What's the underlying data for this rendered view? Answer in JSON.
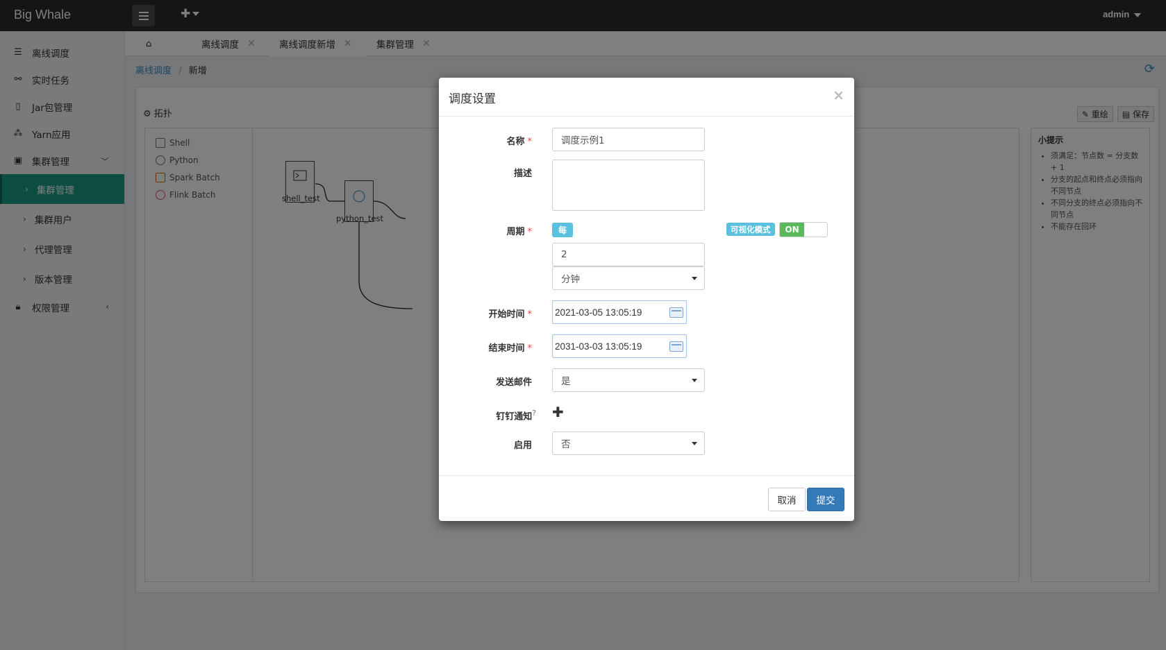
{
  "app": {
    "brand": "Big Whale",
    "user": "admin"
  },
  "sidebar": {
    "items": [
      {
        "label": "离线调度",
        "icon": "list-icon"
      },
      {
        "label": "实时任务",
        "icon": "link-icon"
      },
      {
        "label": "Jar包管理",
        "icon": "file-icon"
      },
      {
        "label": "Yarn应用",
        "icon": "cubes-icon"
      },
      {
        "label": "集群管理",
        "icon": "server-icon"
      },
      {
        "label": "权限管理",
        "icon": "lock-icon"
      }
    ],
    "sub_items": [
      {
        "label": "集群管理",
        "active": true
      },
      {
        "label": "集群用户",
        "active": false
      },
      {
        "label": "代理管理",
        "active": false
      },
      {
        "label": "版本管理",
        "active": false
      }
    ]
  },
  "tabs": [
    {
      "label": "离线调度"
    },
    {
      "label": "离线调度新增"
    },
    {
      "label": "集群管理"
    }
  ],
  "breadcrumb": {
    "parent": "离线调度",
    "current": "新增"
  },
  "panel": {
    "title": "拓扑",
    "redraw_label": "重绘",
    "save_label": "保存",
    "palette": [
      "Shell",
      "Python",
      "Spark Batch",
      "Flink Batch"
    ],
    "nodes": [
      "shell_test",
      "python_test"
    ],
    "tips_title": "小提示",
    "tips": [
      "须满足：节点数 = 分支数 + 1",
      "分支的起点和终点必须指向不同节点",
      "不同分支的终点必须指向不同节点",
      "不能存在回环"
    ]
  },
  "modal": {
    "title": "调度设置",
    "close": "×",
    "name_label": "名称",
    "name_value": "调度示例1",
    "desc_label": "描述",
    "desc_value": "",
    "period_label": "周期",
    "period_badge": "每",
    "period_value": "2",
    "period_unit": "分钟",
    "visual_mode_label": "可视化模式",
    "visual_mode_state": "ON",
    "start_label": "开始时间",
    "start_value": "2021-03-05 13:05:19",
    "end_label": "结束时间",
    "end_value": "2031-03-03 13:05:19",
    "mail_label": "发送邮件",
    "mail_value": "是",
    "dingding_label": "钉钉通知",
    "dingding_hint": "?",
    "enable_label": "启用",
    "enable_value": "否",
    "cancel_label": "取消",
    "submit_label": "提交"
  },
  "colors": {
    "accent": "#1a9b84",
    "primary": "#337ab7",
    "info": "#5bc0de",
    "success": "#5cb85c"
  }
}
